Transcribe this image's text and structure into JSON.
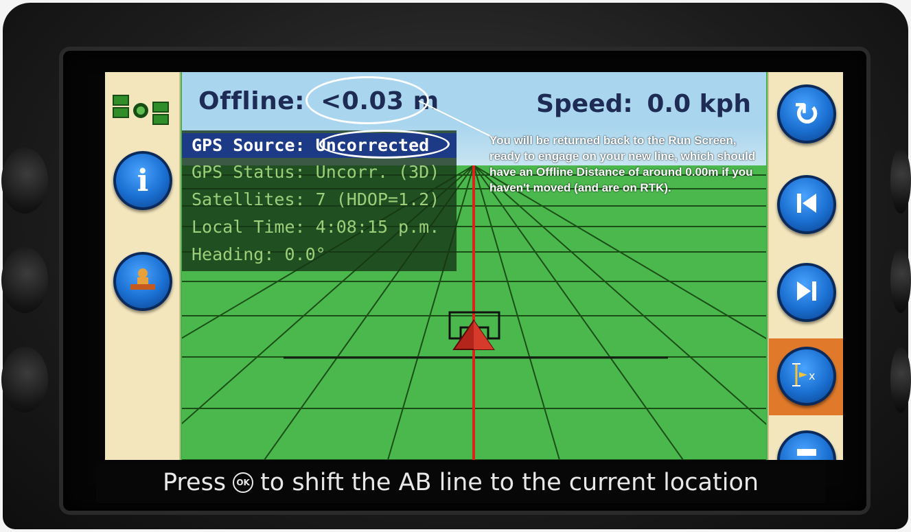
{
  "header": {
    "offline_label": "Offline:",
    "offline_value": "<0.03 m",
    "speed_label": "Speed:",
    "speed_value": "0.0 kph"
  },
  "gps_info": [
    {
      "label": "GPS Source:",
      "value": "Uncorrected"
    },
    {
      "label": "GPS Status:",
      "value": "Uncorr. (3D)"
    },
    {
      "label": "Satellites:",
      "value": "7 (HDOP=1.2)"
    },
    {
      "label": "Local Time:",
      "value": "4:08:15 p.m."
    },
    {
      "label": "Heading:",
      "value": "0.0°"
    }
  ],
  "annotation": {
    "text": "You will be returned back to the Run Screen, ready to engage on your new line, which should have an Offline Distance of around 0.00m if you haven't moved (and are on RTK)."
  },
  "status_bar": {
    "prefix": "Press",
    "ok_icon_label": "OK",
    "suffix": "to shift the AB line to the current location"
  },
  "icons": {
    "left": [
      "satellite-icon",
      "info-icon",
      "implement-icon"
    ],
    "right": [
      "refresh-icon",
      "skip-back-icon",
      "skip-forward-icon",
      "ab-line-shift-icon",
      "menu-icon"
    ]
  },
  "colors": {
    "panel": "#f3e6bd",
    "field": "#4ab84d",
    "sky": "#a9d5ee",
    "button_blue": "#1a6fd0",
    "highlight_orange": "#e07a2a",
    "guidance_line": "#d8251c"
  }
}
